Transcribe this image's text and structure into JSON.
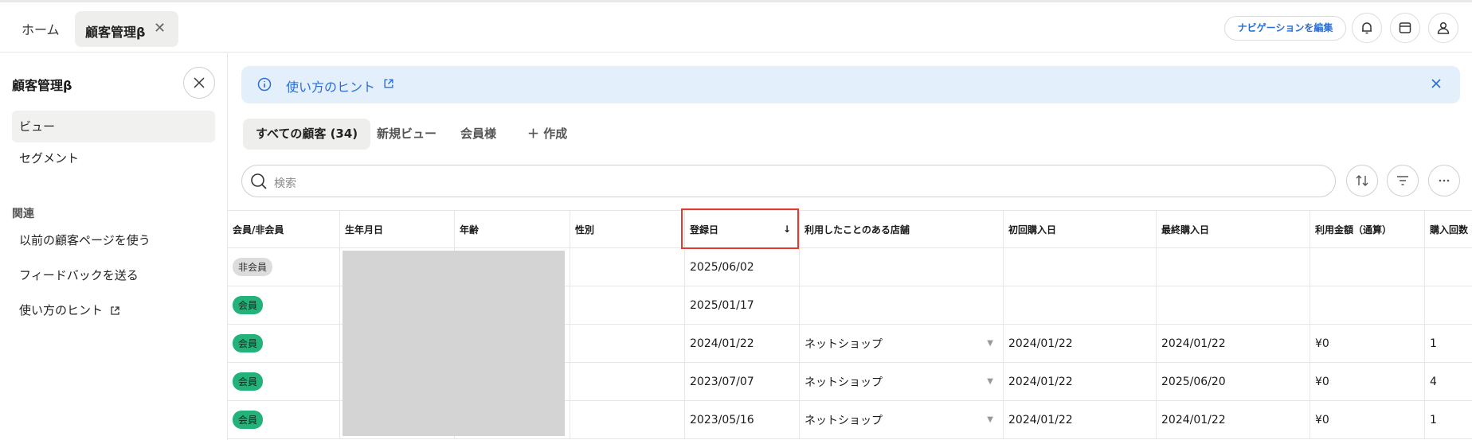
{
  "header": {
    "home_tab": "ホーム",
    "active_tab": "顧客管理β",
    "close_glyph": "✕",
    "edit_nav": "ナビゲーションを編集",
    "icons": [
      "bell-icon",
      "store-icon",
      "user-icon"
    ]
  },
  "sidebar": {
    "title": "顧客管理β",
    "items": [
      {
        "label": "ビュー",
        "active": true
      },
      {
        "label": "セグメント",
        "active": false
      }
    ],
    "section_label": "関連",
    "related": [
      {
        "label": "以前の顧客ページを使う"
      },
      {
        "label": "フィードバックを送る"
      },
      {
        "label": "使い方のヒント"
      }
    ]
  },
  "hint": {
    "text": "使い方のヒント"
  },
  "view_tabs": [
    {
      "label": "すべての顧客 (34)",
      "active": true
    },
    {
      "label": "新規ビュー"
    },
    {
      "label": "会員様"
    },
    {
      "label": "＋ 作成"
    }
  ],
  "search": {
    "placeholder": "検索"
  },
  "table": {
    "columns": [
      "会員/非会員",
      "生年月日",
      "年齢",
      "性別",
      "登録日",
      "利用したことのある店舗",
      "初回購入日",
      "最終購入日",
      "利用金額（通算）",
      "購入回数"
    ],
    "sort_indicator": "↓",
    "rows": [
      {
        "member": "非会員",
        "reg": "2025/06/02",
        "store": "",
        "first": "",
        "last": "",
        "amount": "",
        "count": ""
      },
      {
        "member": "会員",
        "reg": "2025/01/17",
        "store": "",
        "first": "",
        "last": "",
        "amount": "",
        "count": ""
      },
      {
        "member": "会員",
        "reg": "2024/01/22",
        "store": "ネットショップ",
        "first": "2024/01/22",
        "last": "2024/01/22",
        "amount": "¥0",
        "count": "1"
      },
      {
        "member": "会員",
        "reg": "2023/07/07",
        "store": "ネットショップ",
        "first": "2024/01/22",
        "last": "2025/06/20",
        "amount": "¥0",
        "count": "4"
      },
      {
        "member": "会員",
        "reg": "2023/05/16",
        "store": "ネットショップ",
        "first": "2024/01/22",
        "last": "2024/01/22",
        "amount": "¥0",
        "count": "1"
      }
    ]
  },
  "colors": {
    "accent": "#2b6fd6",
    "member_badge": "#22b27a",
    "highlight": "#e23b2e"
  }
}
